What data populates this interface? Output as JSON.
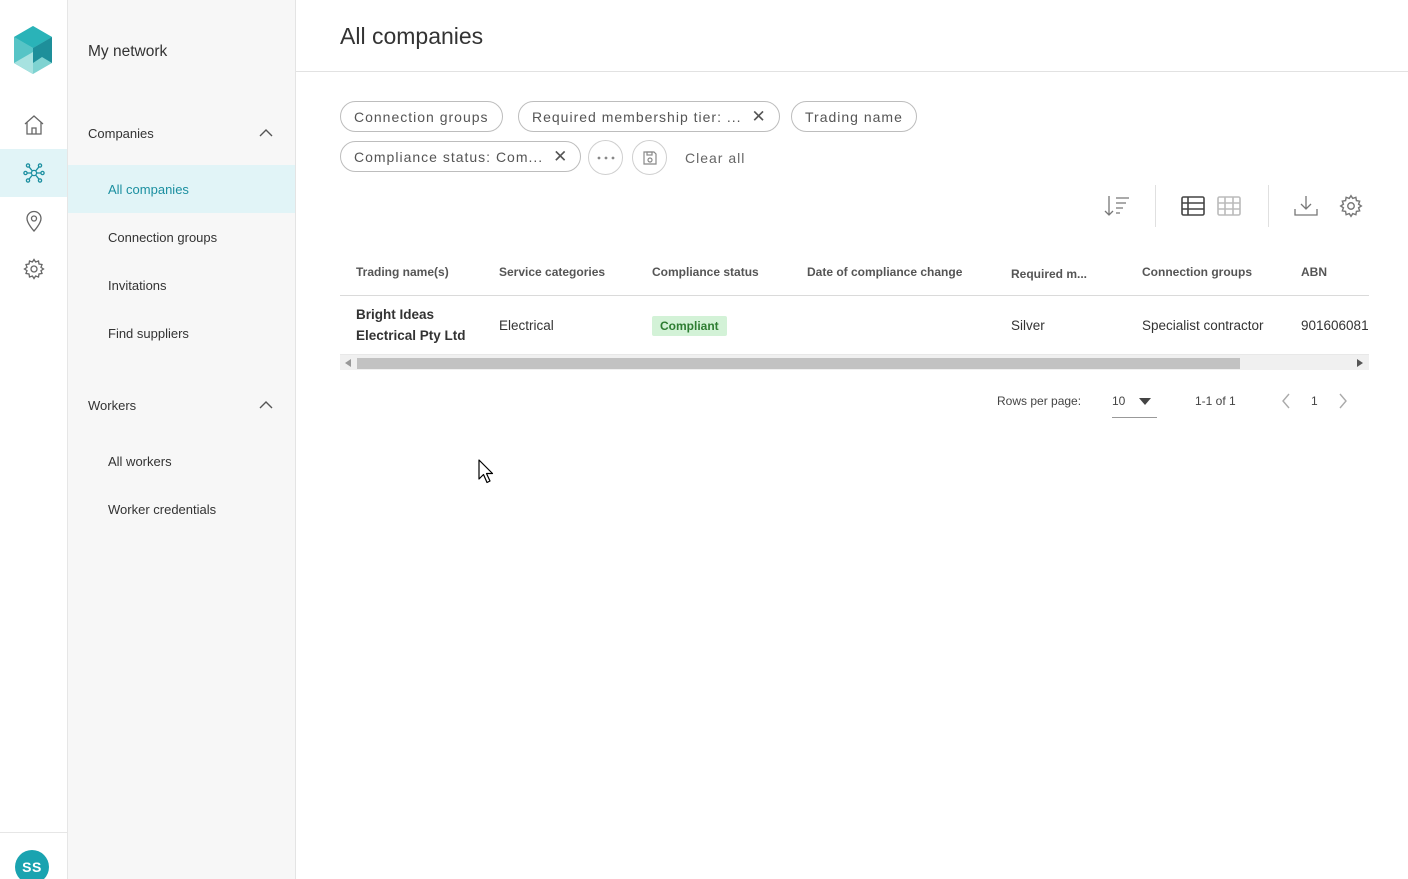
{
  "colors": {
    "accent": "#1b8fa0",
    "active_bg": "#e1f4f7",
    "compliant_bg": "#d3f2d7",
    "compliant_text": "#2e7d32",
    "avatar": "#1aa3b0"
  },
  "rail": {
    "items": [
      {
        "icon": "home-icon"
      },
      {
        "icon": "network-icon",
        "active": true
      },
      {
        "icon": "location-pin-icon"
      },
      {
        "icon": "gear-icon"
      }
    ],
    "avatar_initials": "SS"
  },
  "subnav": {
    "title": "My network",
    "sections": [
      {
        "label": "Companies",
        "items": [
          "All companies",
          "Connection groups",
          "Invitations",
          "Find suppliers"
        ]
      },
      {
        "label": "Workers",
        "items": [
          "All workers",
          "Worker credentials"
        ]
      }
    ]
  },
  "page": {
    "title": "All companies"
  },
  "filters": {
    "chips": [
      "Connection groups",
      "Required membership tier: ...",
      "Trading name",
      "Compliance status: Com..."
    ],
    "clear_all": "Clear all"
  },
  "table": {
    "columns": [
      "Trading name(s)",
      "Service categories",
      "Compliance status",
      "Date of compliance change",
      "Required m...",
      "Connection groups",
      "ABN"
    ],
    "rows": [
      {
        "trading_name_line1": "Bright Ideas",
        "trading_name_line2": "Electrical Pty Ltd",
        "service_categories": "Electrical",
        "compliance_status": "Compliant",
        "date_of_compliance_change": "",
        "required_membership": "Silver",
        "connection_groups": "Specialist contractor",
        "abn": "901606081"
      }
    ]
  },
  "pagination": {
    "rows_per_page_label": "Rows per page:",
    "rows_per_page_value": "10",
    "range_text": "1-1 of 1",
    "current_page": "1"
  }
}
